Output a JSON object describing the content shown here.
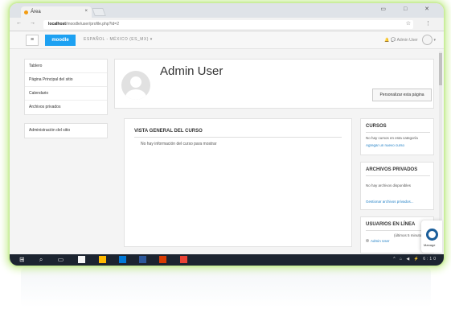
{
  "browser": {
    "tab_title": "Área",
    "tab_close": "×",
    "window_controls": "▭ □ ✕",
    "nav_icons": "← → C",
    "url_host": "localhost",
    "url_path": "/moodle/user/profile.php?id=2",
    "addr_right": "☆ ⋮"
  },
  "navbar": {
    "menu_icon": "≡",
    "logo": "moodle",
    "language": "ESPAÑOL - MÉXICO (ES_MX) ▾",
    "bell_icon": "🔔",
    "chat_icon": "💬",
    "user_name": "Admin User",
    "dropdown": "▾"
  },
  "sidebar": {
    "items_group1": [
      {
        "label": "Tablero"
      },
      {
        "label": "Página Principal del sitio"
      },
      {
        "label": "Calendario"
      },
      {
        "label": "Archivos privados"
      }
    ],
    "items_group2": [
      {
        "label": "Administración del sitio"
      }
    ]
  },
  "profile": {
    "name": "Admin User",
    "customize_button": "Personalizar esta página"
  },
  "course_overview": {
    "heading": "VISTA GENERAL DEL CURSO",
    "info": "No hay información del curso para mostrar"
  },
  "blocks": {
    "courses": {
      "title": "CURSOS",
      "text": "No hay cursos en esta categoría",
      "link": "Agregar un nuevo curso"
    },
    "private_files": {
      "title": "ARCHIVOS PRIVADOS",
      "text": "No hay archivos disponibles",
      "link": "Gestionar archivos privados..."
    },
    "online_users": {
      "title": "USUARIOS EN LÍNEA",
      "count": "(últimos 5 minutos: 1)",
      "user": "Admin User"
    }
  },
  "watermark": {
    "text": "Manage"
  },
  "taskbar": {
    "icons": "⊞ ⌕ ▭",
    "tray": "^ ⌂ ◀ ⚡ 6:10"
  },
  "colors": {
    "accent": "#1da1f2",
    "link": "#1f7fc5",
    "frame_glow": "#c9ee96",
    "taskbar": "#1c2430"
  }
}
